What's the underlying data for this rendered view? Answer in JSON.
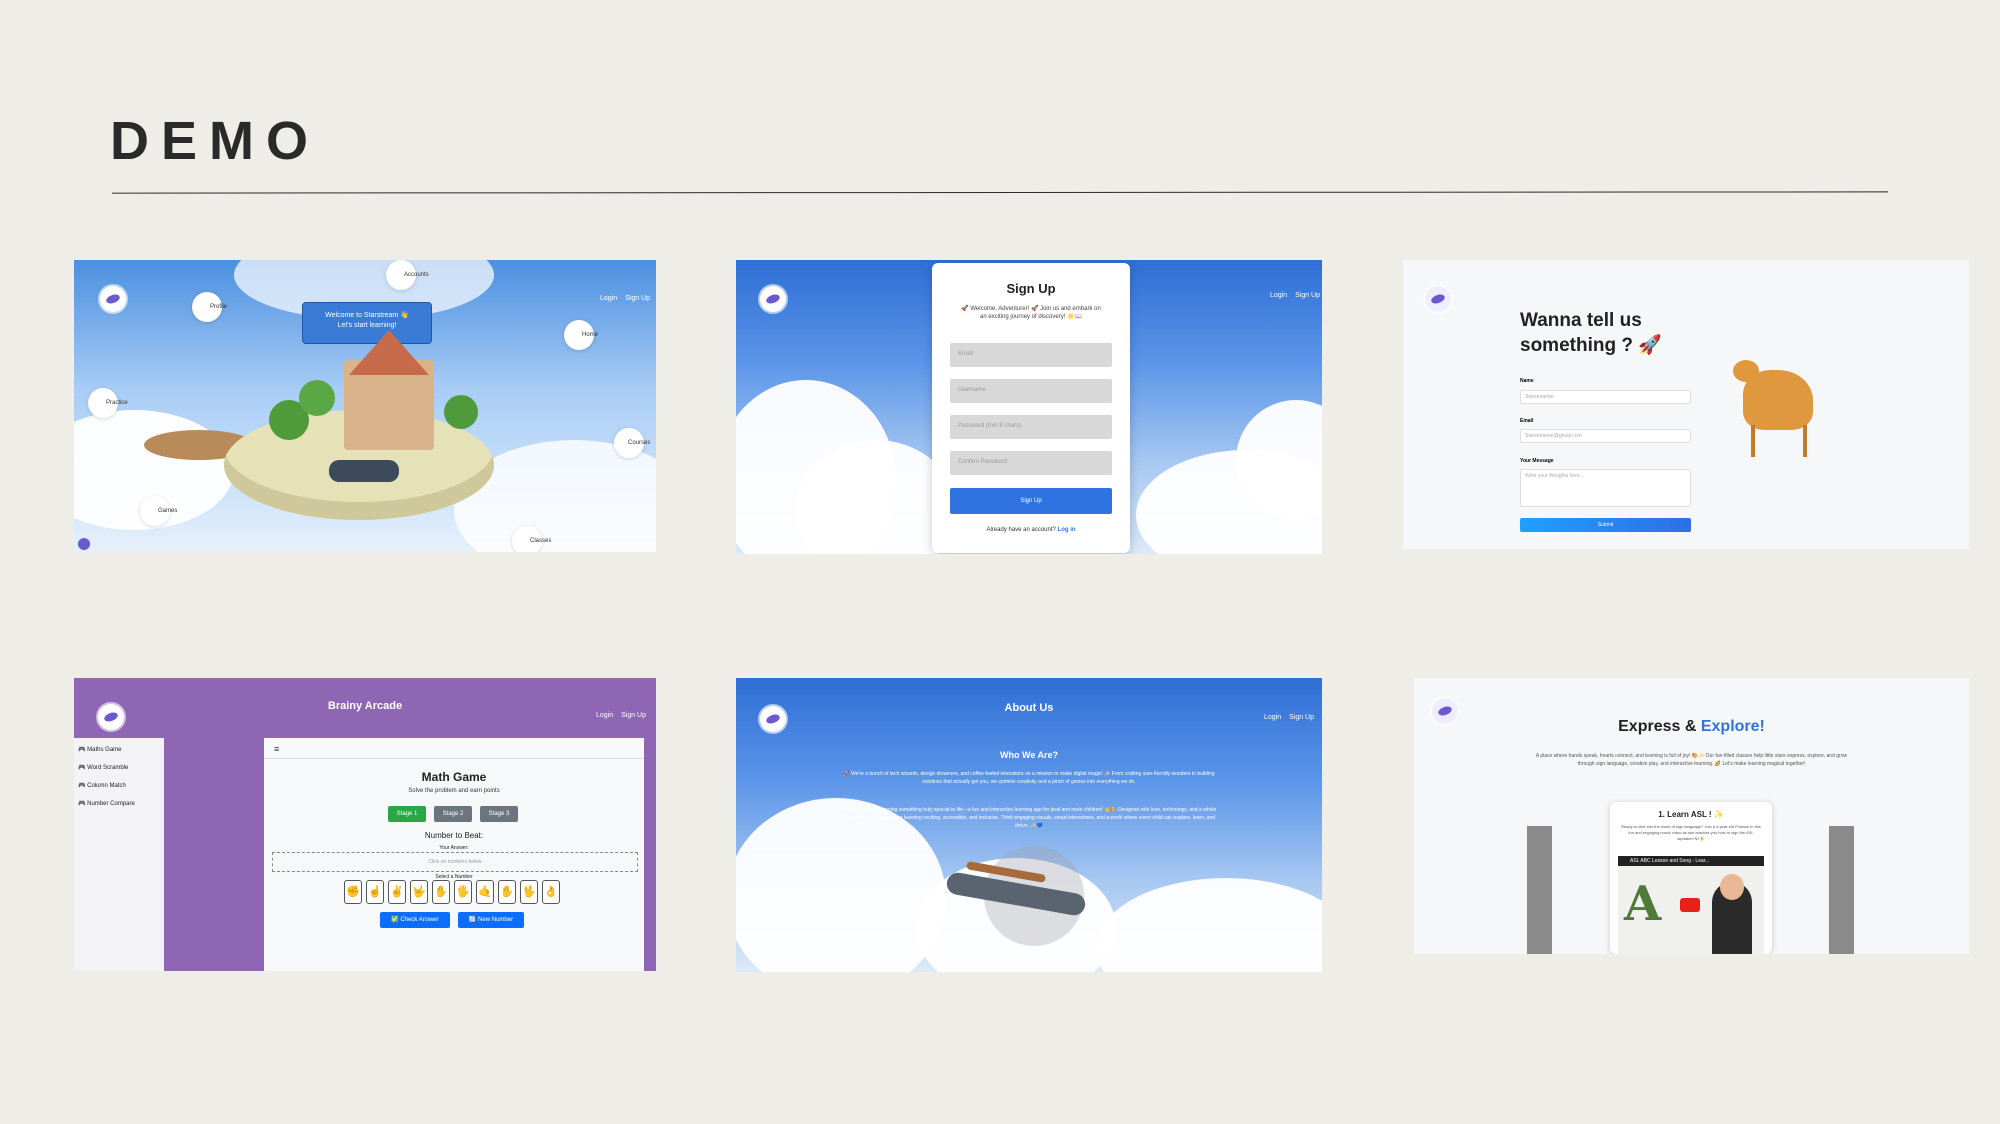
{
  "slide": {
    "title": "DEMO"
  },
  "shot1": {
    "nav": {
      "login": "Login",
      "signup": "Sign Up"
    },
    "welcome_line1": "Welcome to Starstream 👋",
    "welcome_line2": "Let's start learning!",
    "bubbles": [
      "Profile",
      "Accounts",
      "Home",
      "Practice",
      "Courses",
      "Games",
      "Classes"
    ]
  },
  "shot2": {
    "nav": {
      "login": "Login",
      "signup": "Sign Up"
    },
    "title": "Sign Up",
    "subtitle": "🚀 Welcome, Adventurer! 🚀 Join us and embark on an exciting journey of discovery! 🌟📖",
    "fields": [
      "Email",
      "Username",
      "Password (min 8 chars)",
      "Confirm Password"
    ],
    "submit": "Sign Up",
    "footer_prefix": "Already have an account? ",
    "footer_link": "Log in"
  },
  "shot3": {
    "heading_line1": "Wanna tell us",
    "heading_line2": "something ? 🚀",
    "label_name": "Name",
    "placeholder_name": "Starstreamer",
    "label_email": "Email",
    "placeholder_email": "Starstreamer@gmail.com",
    "label_message": "Your Message",
    "placeholder_message": "Write your thoughts here...",
    "submit": "Submit"
  },
  "shot4": {
    "title": "Brainy Arcade",
    "nav": {
      "login": "Login",
      "signup": "Sign Up"
    },
    "sidebar": [
      "Maths Game",
      "Word Scramble",
      "Column Match",
      "Number Compare"
    ],
    "menu_icon": "≡",
    "game_title": "Math Game",
    "game_subtitle": "Solve the problem and earn points",
    "stages": [
      "Stage 1",
      "Stage 2",
      "Stage 3"
    ],
    "number_to_beat": "Number to Beat:",
    "your_answer": "Your Answer:",
    "answer_placeholder": "Click on numbers below",
    "select_number": "Select a Number",
    "check_answer": "✅ Check Answer",
    "new_number": "🔄 New Number",
    "colors": {
      "active_stage": "#28a745",
      "stage": "#6c757d",
      "button": "#0d6efd"
    }
  },
  "shot5": {
    "title": "About Us",
    "nav": {
      "login": "Login",
      "signup": "Sign Up"
    },
    "heading": "Who We Are?",
    "para1": "🚀 We're a bunch of tech wizards, design dreamers, and coffee-fueled innovators on a mission to make digital magic! ✨ From crafting user-friendly wonders to building solutions that actually get you, we sprinkle creativity and a pinch of genius into everything we do.",
    "para2": "Right now, we're bringing something truly special to life—a fun and interactive learning app for deaf and mute children! 👋🎨 Designed with love, technology, and a whole lot of heart, our app makes learning exciting, accessible, and inclusive. Think engaging visuals, smart interactions, and a world where every child can explore, learn, and thrive. ✨💙"
  },
  "shot6": {
    "heading_a": "Express & ",
    "heading_b": "Explore!",
    "description": "A place where hands speak, hearts connect, and learning is full of joy! 🎨✨ Our fun-filled classes help little stars express, explore, and grow through sign language, creative play, and interactive learning. 🌈 Let's make learning magical together!",
    "card_title": "1. Learn ASL ! ✨",
    "card_text": "Ready to dive into the world of sign language? Join a 4-year-old Finesse in this fun and engaging music video as she teaches you how to sign the ASL alphabet! 🎶✋",
    "video_title": "ASL ABC Lesson and Song - Lear...",
    "accent": "#2f73e0"
  }
}
